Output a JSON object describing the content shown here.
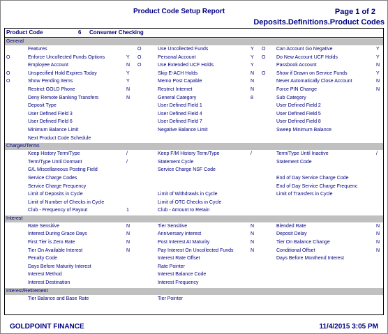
{
  "report": {
    "title": "Product Code Setup Report",
    "page": "Page 1 of 2",
    "path": "Deposits.Definitions.Product Codes",
    "product_code_label": "Product Code",
    "product_code_value": "6",
    "product_name": "Consumer Checking"
  },
  "sections": [
    {
      "name": "General",
      "rows": [
        [
          [
            "",
            "Features",
            ""
          ],
          [
            "O",
            "Use Uncollected Funds",
            "Y"
          ],
          [
            "O",
            "Can Account Go Negative",
            "Y"
          ]
        ],
        [
          [
            "O",
            "Enforce Uncollected Funds Options",
            "Y"
          ],
          [
            "O",
            "Personal Account",
            "Y"
          ],
          [
            "O",
            "Do New Account UCF Holds",
            "Y"
          ]
        ],
        [
          [
            "",
            "Employee Account",
            "N"
          ],
          [
            "O",
            "Use Extended UCF Holds",
            "Y"
          ],
          [
            "",
            "Passbook Account",
            "N"
          ]
        ],
        [
          [
            "O",
            "Unspecified Hold Expires Today",
            "Y"
          ],
          [
            "",
            "Skip E-ACH Holds",
            "N"
          ],
          [
            "O",
            "Show if Drawn on Service Funds",
            "Y"
          ]
        ],
        [
          [
            "O",
            "Show Pending Items",
            "Y"
          ],
          [
            "",
            "Memo Post Capable",
            "N"
          ],
          [
            "",
            "Never Automatically Close Account",
            "N"
          ]
        ],
        [
          [
            "",
            "Restrict GOLD Phone",
            "N"
          ],
          [
            "",
            "Restrict Internet",
            "N"
          ],
          [
            "",
            "Force PIN Change",
            "N"
          ]
        ],
        [
          [
            "",
            "Deny Remote Banking Transfers",
            "N"
          ],
          [
            "",
            "General Category",
            "8"
          ],
          [
            "",
            "Sub Category",
            ""
          ]
        ],
        [
          [
            "",
            "Deposit Type",
            ""
          ],
          [
            "",
            "User Defined Field 1",
            ""
          ],
          [
            "",
            "User Defined Field 2",
            ""
          ]
        ],
        [
          [
            "",
            "User Defined Field 3",
            ""
          ],
          [
            "",
            "User Defined Field 4",
            ""
          ],
          [
            "",
            "User Defined Field 5",
            ""
          ]
        ],
        [
          [
            "",
            "User Defined Field 6",
            ""
          ],
          [
            "",
            "User Defined Field 7",
            ""
          ],
          [
            "",
            "User Defined Field 8",
            ""
          ]
        ],
        [
          [
            "",
            "Minimum Balance Limit",
            ""
          ],
          [
            "",
            "Negative Balance Limit",
            ""
          ],
          [
            "",
            "Sweep Minimum Balance",
            ""
          ]
        ],
        [
          [
            "",
            "Next Product Code Schedule",
            ""
          ],
          [
            "",
            "",
            ""
          ],
          [
            "",
            "",
            ""
          ]
        ]
      ]
    },
    {
      "name": "Charges/Terms",
      "rows": [
        [
          [
            "",
            "Keep History Term/Type",
            "/"
          ],
          [
            "",
            "Keep F/M History Term/Type",
            "/"
          ],
          [
            "",
            "Term/Type Until Inactive",
            "/"
          ]
        ],
        [
          [
            "",
            "Term/Type Until Dormant",
            "/"
          ],
          [
            "",
            "Statement Cycle",
            ""
          ],
          [
            "",
            "Statement Code",
            ""
          ]
        ],
        [
          [
            "",
            "G/L Miscellaneous Posting Field",
            ""
          ],
          [
            "",
            "Service Charge NSF Code",
            ""
          ],
          [
            "",
            "",
            ""
          ]
        ],
        [
          [
            "",
            "Service Charge Codes",
            ""
          ],
          [
            "",
            "",
            ""
          ],
          [
            "",
            "End of Day Service Charge Code",
            ""
          ]
        ],
        [
          [
            "",
            "Service Charge Frequency",
            ""
          ],
          [
            "",
            "",
            ""
          ],
          [
            "",
            "End of Day Service Charge Frequenc",
            ""
          ]
        ],
        [
          [
            "",
            "Limit of Deposits in Cycle",
            ""
          ],
          [
            "",
            "Limit of Withdrawls in Cycle",
            ""
          ],
          [
            "",
            "Limit of Transfers in Cycle",
            ""
          ]
        ],
        [
          [
            "",
            "Limit of Number of Checks in Cycle",
            ""
          ],
          [
            "",
            "Limit of OTC Checks in Cycle",
            ""
          ],
          [
            "",
            "",
            ""
          ]
        ],
        [
          [
            "",
            "Club - Frequency of Payout",
            "1"
          ],
          [
            "",
            "Club - Amount to Retain",
            ""
          ],
          [
            "",
            "",
            ""
          ]
        ]
      ]
    },
    {
      "name": "Interest",
      "rows": [
        [
          [
            "",
            "Rate Sensitive",
            "N"
          ],
          [
            "",
            "Tier Sensitive",
            "N"
          ],
          [
            "",
            "Blended Rate",
            "N"
          ]
        ],
        [
          [
            "",
            "Interest During Grace Days",
            "N"
          ],
          [
            "",
            "Anniversary Interest",
            "N"
          ],
          [
            "",
            "Deposit Delay",
            "N"
          ]
        ],
        [
          [
            "",
            "First Tier is Zero Rate",
            "N"
          ],
          [
            "",
            "Post Interest At Maturity",
            "N"
          ],
          [
            "",
            "Tier On Balance Change",
            "N"
          ]
        ],
        [
          [
            "",
            "Tier On Available Interest",
            "N"
          ],
          [
            "",
            "Pay Interest On Uncollected Funds",
            "N"
          ],
          [
            "",
            "Conditional Offset",
            "N"
          ]
        ],
        [
          [
            "",
            "Penalty Code",
            ""
          ],
          [
            "",
            "Interest Rate Offset",
            ""
          ],
          [
            "",
            "Days Before Monthend Interest",
            ""
          ]
        ],
        [
          [
            "",
            "Days Before Maturity Interest",
            ""
          ],
          [
            "",
            "Rate Pointer",
            ""
          ],
          [
            "",
            "",
            ""
          ]
        ],
        [
          [
            "",
            "Interest Method",
            ""
          ],
          [
            "",
            "Interest Balance Code",
            ""
          ],
          [
            "",
            "",
            ""
          ]
        ],
        [
          [
            "",
            "Interest Destination",
            ""
          ],
          [
            "",
            "Interest Frequency",
            ""
          ],
          [
            "",
            "",
            ""
          ]
        ]
      ]
    },
    {
      "name": "Interest/Retirement",
      "rows": [
        [
          [
            "",
            "Tier Balance and Base Rate",
            ""
          ],
          [
            "",
            "Tier Pointer",
            ""
          ],
          [
            "",
            "",
            ""
          ]
        ]
      ]
    }
  ],
  "footer": {
    "company": "GOLDPOINT FINANCE",
    "datetime": "11/4/2015 3:05 PM"
  }
}
